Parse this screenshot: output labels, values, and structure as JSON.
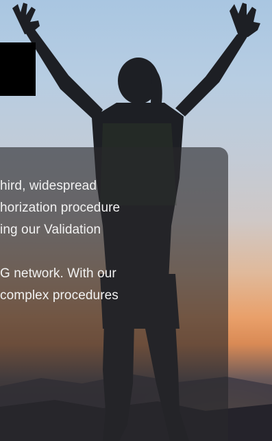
{
  "hero": {
    "background_colors": {
      "sky_top": "#a9c6e1",
      "horizon_glow": "#e9a06a",
      "ground": "#2a2830",
      "silhouette": "#1d1f24"
    },
    "subject_icon": "raised-arms-silhouette-icon"
  },
  "overlay": {
    "card_color": "#28282c",
    "text_color": "#f2f2f2",
    "paragraph_1": [
      "hird, widespread",
      "horization procedure",
      "ing our Validation"
    ],
    "paragraph_2": [
      "G network. With our",
      " complex procedures"
    ]
  }
}
